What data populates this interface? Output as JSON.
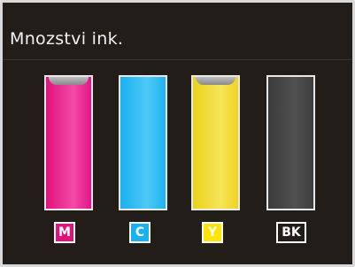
{
  "screen": {
    "title": "Mnozstvi ink."
  },
  "cartridges": [
    {
      "label": "M",
      "level": 1.0,
      "color": "#e0137c"
    },
    {
      "label": "C",
      "level": 1.0,
      "color": "#19b1ef"
    },
    {
      "label": "Y",
      "level": 1.0,
      "color": "#ffe500"
    },
    {
      "label": "BK",
      "level": 1.0,
      "color": "#3b3b3b"
    }
  ]
}
